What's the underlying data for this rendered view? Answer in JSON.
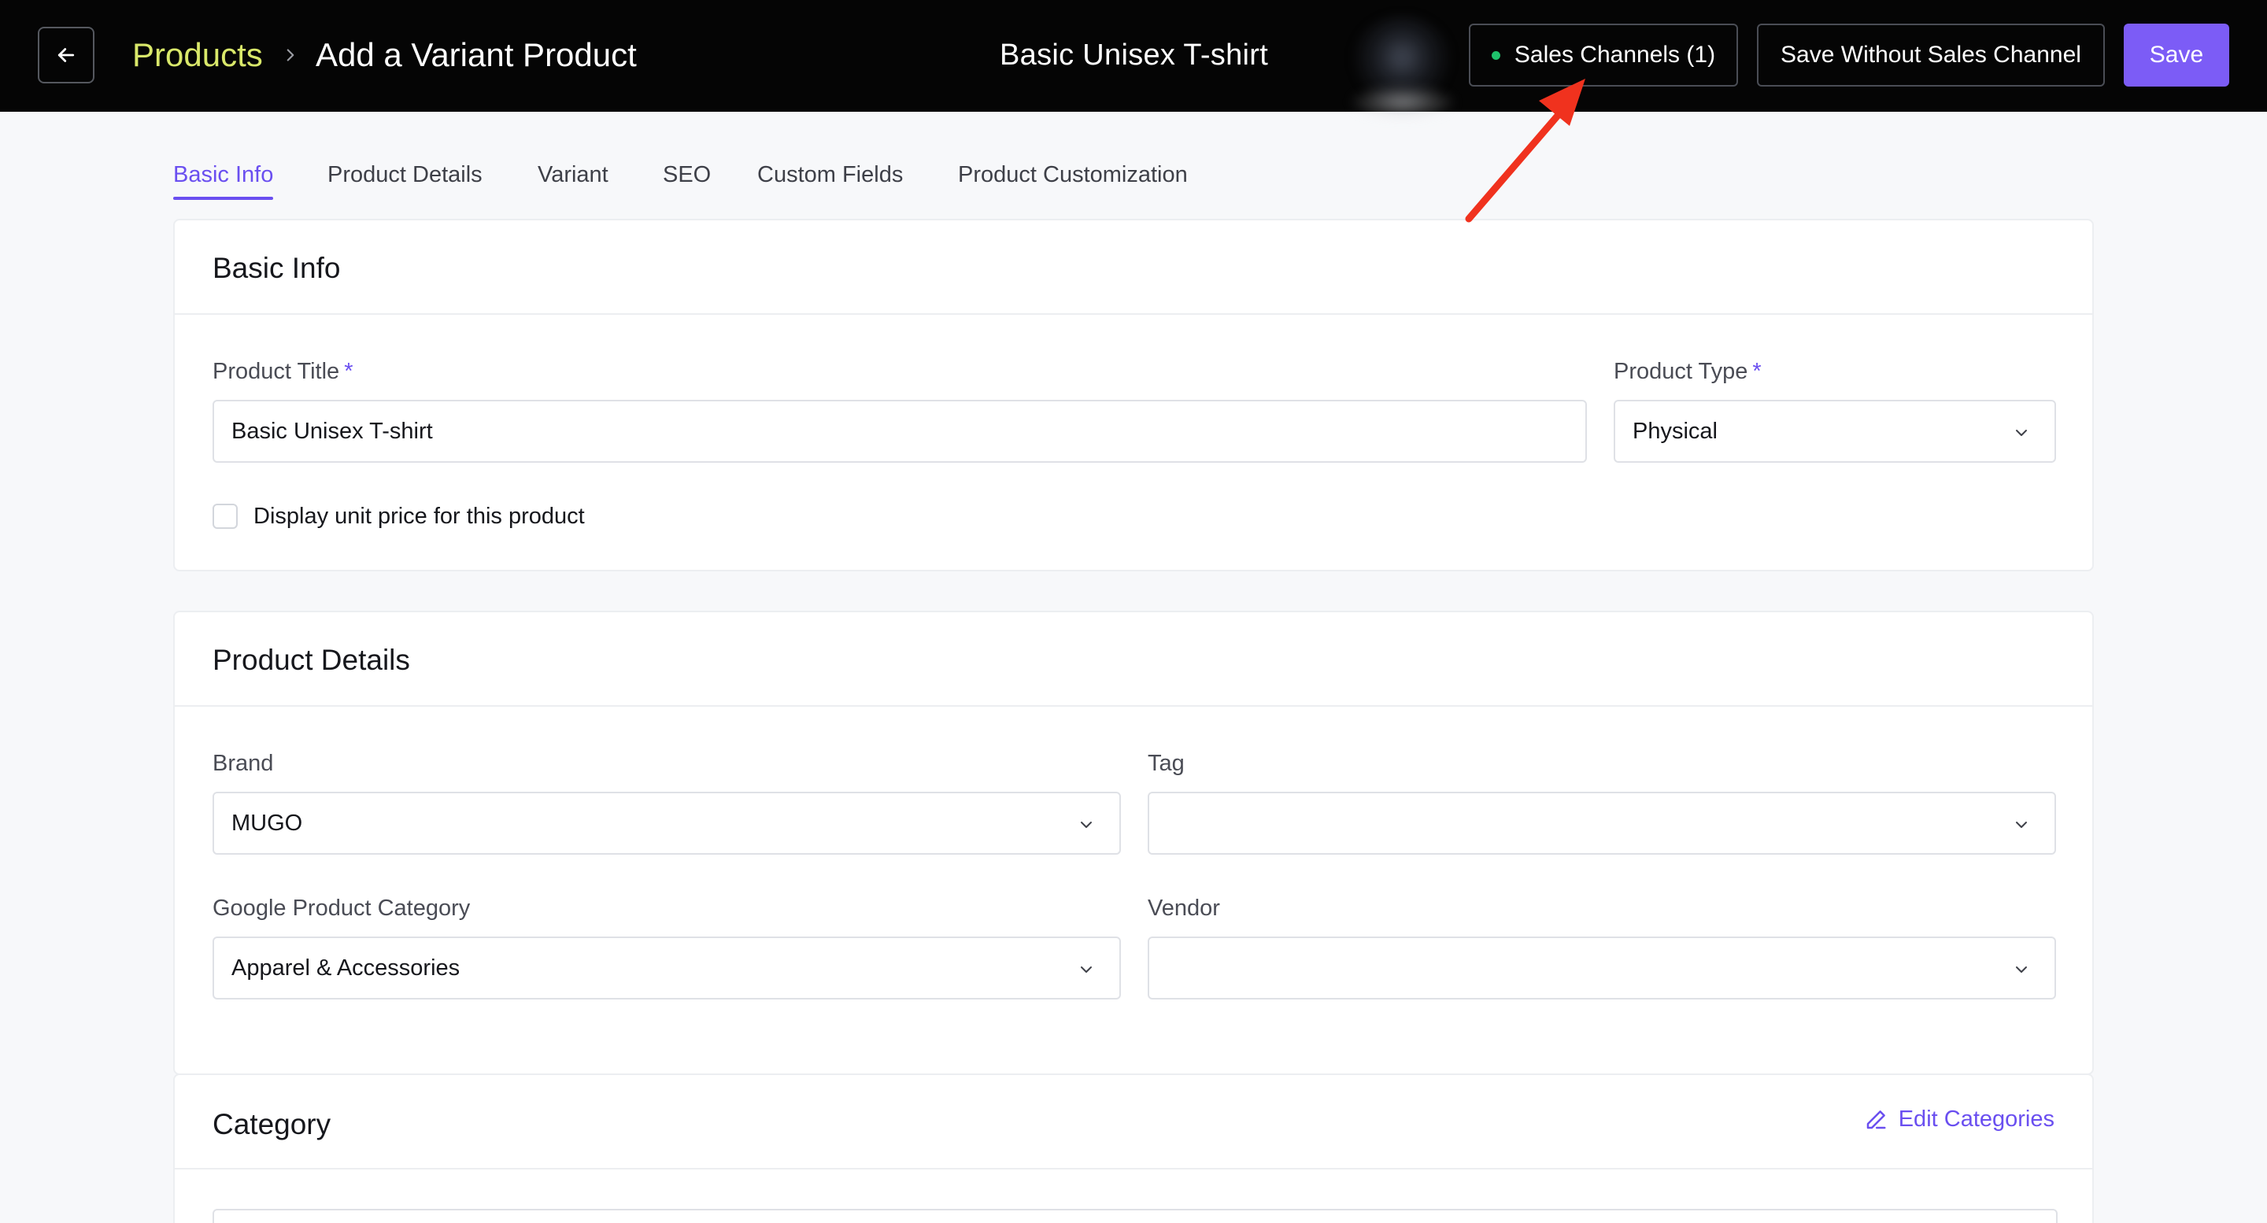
{
  "header": {
    "back_icon": "arrow-left-icon",
    "breadcrumb_root": "Products",
    "breadcrumb_separator_icon": "chevron-right-icon",
    "breadcrumb_current": "Add a Variant Product",
    "product_title": "Basic Unisex T-shirt",
    "sales_channels_label": "Sales Channels (1)",
    "save_without_channel_label": "Save Without Sales Channel",
    "save_label": "Save"
  },
  "tabs": [
    {
      "label": "Basic Info",
      "active": true
    },
    {
      "label": "Product Details",
      "active": false
    },
    {
      "label": "Variant",
      "active": false
    },
    {
      "label": "SEO",
      "active": false
    },
    {
      "label": "Custom Fields",
      "active": false
    },
    {
      "label": "Product Customization",
      "active": false
    }
  ],
  "basic_info": {
    "title": "Basic Info",
    "product_title_label": "Product Title",
    "product_title_value": "Basic Unisex T-shirt",
    "product_type_label": "Product Type",
    "product_type_value": "Physical",
    "required_mark": "*",
    "unit_price_checkbox_label": "Display unit price for this product",
    "unit_price_checked": false
  },
  "product_details": {
    "title": "Product Details",
    "brand_label": "Brand",
    "brand_value": "MUGO",
    "tag_label": "Tag",
    "tag_value": "",
    "google_category_label": "Google Product Category",
    "google_category_value": "Apparel & Accessories",
    "vendor_label": "Vendor",
    "vendor_value": ""
  },
  "category": {
    "title": "Category",
    "edit_label": "Edit Categories",
    "edit_icon": "pencil-icon"
  },
  "colors": {
    "topbar_bg": "#050505",
    "breadcrumb_root": "#d9e86a",
    "accent": "#7c5cf6",
    "status_dot": "#1fc16b",
    "annotation_arrow": "#f0321e"
  }
}
